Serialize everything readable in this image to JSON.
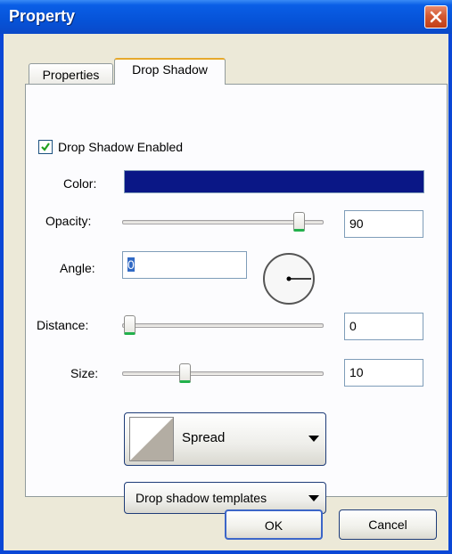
{
  "window": {
    "title": "Property"
  },
  "tabs": [
    {
      "label": "Properties",
      "active": false
    },
    {
      "label": "Drop Shadow",
      "active": true
    }
  ],
  "drop_shadow": {
    "enabled_label": "Drop Shadow Enabled",
    "enabled": true,
    "color_label": "Color:",
    "color_value": "#0a1786",
    "opacity_label": "Opacity:",
    "opacity_value": "90",
    "angle_label": "Angle:",
    "angle_value": "0",
    "distance_label": "Distance:",
    "distance_value": "0",
    "size_label": "Size:",
    "size_value": "10",
    "spread_label": "Spread",
    "templates_label": "Drop shadow templates"
  },
  "buttons": {
    "ok": "OK",
    "cancel": "Cancel"
  },
  "colors": {
    "title_bar": "#0653d8",
    "dialog_bg": "#ece9d8",
    "slider_accent": "#22b14c",
    "tab_highlight": "#e6a92c"
  }
}
